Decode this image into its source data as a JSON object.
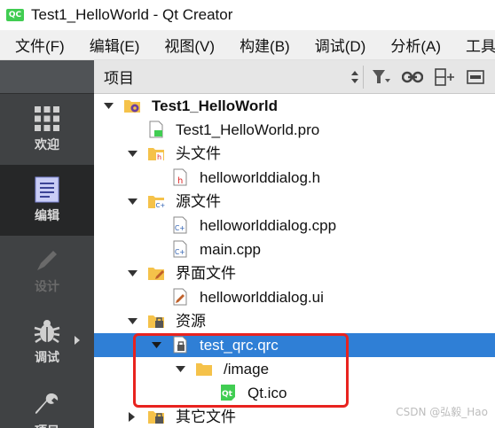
{
  "window": {
    "app_badge": "QC",
    "title": "Test1_HelloWorld - Qt Creator"
  },
  "menu": [
    "文件(F)",
    "编辑(E)",
    "视图(V)",
    "构建(B)",
    "调试(D)",
    "分析(A)",
    "工具(T)"
  ],
  "modes": [
    {
      "label": "欢迎",
      "icon": "welcome-grid-icon"
    },
    {
      "label": "编辑",
      "icon": "edit-document-icon"
    },
    {
      "label": "设计",
      "icon": "design-pen-icon"
    },
    {
      "label": "调试",
      "icon": "debug-bug-icon"
    },
    {
      "label": "项目",
      "icon": "projects-wrench-icon"
    }
  ],
  "panel": {
    "title": "项目"
  },
  "tree": [
    {
      "label": "Test1_HelloWorld",
      "icon": "project-folder-icon",
      "bold": true
    },
    {
      "label": "Test1_HelloWorld.pro",
      "icon": "pro-file-icon"
    },
    {
      "label": "头文件",
      "icon": "header-folder-icon"
    },
    {
      "label": "helloworlddialog.h",
      "icon": "header-file-icon"
    },
    {
      "label": "源文件",
      "icon": "source-folder-icon"
    },
    {
      "label": "helloworlddialog.cpp",
      "icon": "cpp-file-icon"
    },
    {
      "label": "main.cpp",
      "icon": "cpp-file-icon"
    },
    {
      "label": "界面文件",
      "icon": "forms-folder-icon"
    },
    {
      "label": "helloworlddialog.ui",
      "icon": "ui-file-icon"
    },
    {
      "label": "资源",
      "icon": "resources-folder-icon"
    },
    {
      "label": "test_qrc.qrc",
      "icon": "qrc-file-icon",
      "selected": true
    },
    {
      "label": "/image",
      "icon": "folder-icon"
    },
    {
      "label": "Qt.ico",
      "icon": "qt-ico-icon"
    },
    {
      "label": "其它文件",
      "icon": "other-folder-icon"
    }
  ],
  "watermark": "CSDN @弘毅_Hao",
  "colors": {
    "selection": "#2f7fd6",
    "mode_bar": "#404244",
    "qt_green": "#41cd52",
    "highlight": "#e8231f"
  }
}
